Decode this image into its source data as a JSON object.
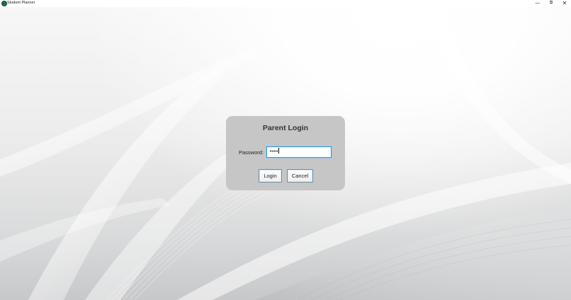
{
  "window": {
    "title": "Student Planner",
    "controls": {
      "minimize": "—",
      "maximize": "⧉",
      "close": "✕"
    },
    "app_icon_color": "#1f6f4a"
  },
  "dialog": {
    "title": "Parent Login",
    "password_label": "Password:",
    "password_value": "••••",
    "login_label": "Login",
    "cancel_label": "Cancel",
    "background_color": "#c6c6c6",
    "focus_color": "#3a93d6"
  }
}
